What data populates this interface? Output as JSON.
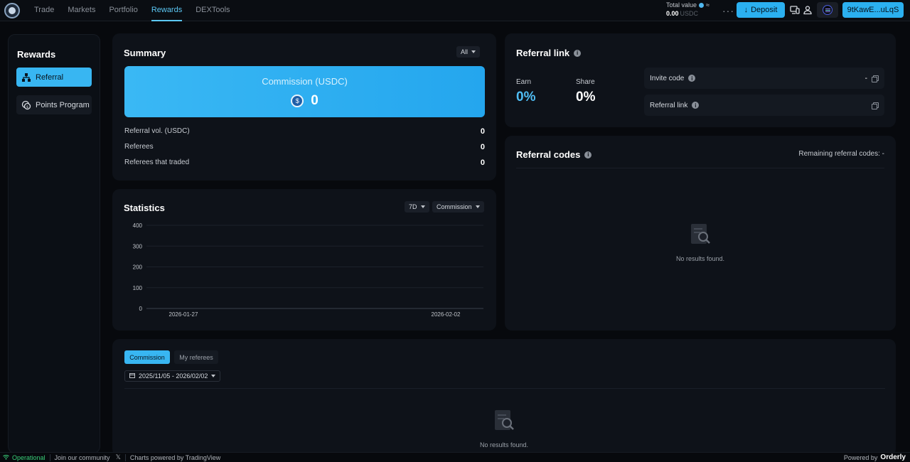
{
  "nav": {
    "items": [
      {
        "label": "Trade",
        "active": false
      },
      {
        "label": "Markets",
        "active": false
      },
      {
        "label": "Portfolio",
        "active": false
      },
      {
        "label": "Rewards",
        "active": true
      },
      {
        "label": "DEXTools",
        "active": false
      }
    ]
  },
  "header": {
    "total_value_label": "Total value",
    "total_value_mask": "≈",
    "total_value": "0.00",
    "total_value_unit": "USDC",
    "more": "···",
    "deposit_label": "Deposit",
    "wallet_label": "9tKawE...uLqS"
  },
  "sidebar": {
    "title": "Rewards",
    "items": [
      {
        "label": "Referral",
        "active": true,
        "icon": "referral-tree-icon"
      },
      {
        "label": "Points Program",
        "active": false,
        "icon": "points-coin-icon"
      }
    ]
  },
  "summary": {
    "title": "Summary",
    "filter": "All",
    "commission_label": "Commission (USDC)",
    "commission_value": "0",
    "rows": [
      {
        "label": "Referral vol. (USDC)",
        "value": "0"
      },
      {
        "label": "Referees",
        "value": "0"
      },
      {
        "label": "Referees that traded",
        "value": "0"
      }
    ]
  },
  "statistics": {
    "title": "Statistics",
    "range": "7D",
    "metric": "Commission"
  },
  "chart_data": {
    "type": "line",
    "title": "Statistics",
    "x": [
      "2026-01-27",
      "2026-02-02"
    ],
    "xlabel": "",
    "ylabel": "",
    "ylim": [
      0,
      400
    ],
    "yticks": [
      0,
      100,
      200,
      300,
      400
    ],
    "series": [],
    "grid": true
  },
  "referral_link": {
    "title": "Referral link",
    "earn_label": "Earn",
    "earn_value": "0%",
    "share_label": "Share",
    "share_value": "0%",
    "invite_code_label": "Invite code",
    "invite_code_value": "-",
    "referral_link_label": "Referral link"
  },
  "referral_codes": {
    "title": "Referral codes",
    "remaining_label": "Remaining referral codes: -",
    "empty_text": "No results found."
  },
  "bottom": {
    "tabs": [
      {
        "label": "Commission",
        "active": true
      },
      {
        "label": "My referees",
        "active": false
      }
    ],
    "date_range": "2025/11/05 - 2026/02/02",
    "empty_text": "No results found."
  },
  "footer": {
    "status": "Operational",
    "community": "Join our community",
    "charts": "Charts powered by TradingView",
    "powered_by": "Powered by",
    "brand": "Orderly"
  },
  "colors": {
    "accent": "#2bb0f0",
    "background": "#07090d",
    "card": "#0e1219",
    "status_ok": "#3ad07a"
  }
}
